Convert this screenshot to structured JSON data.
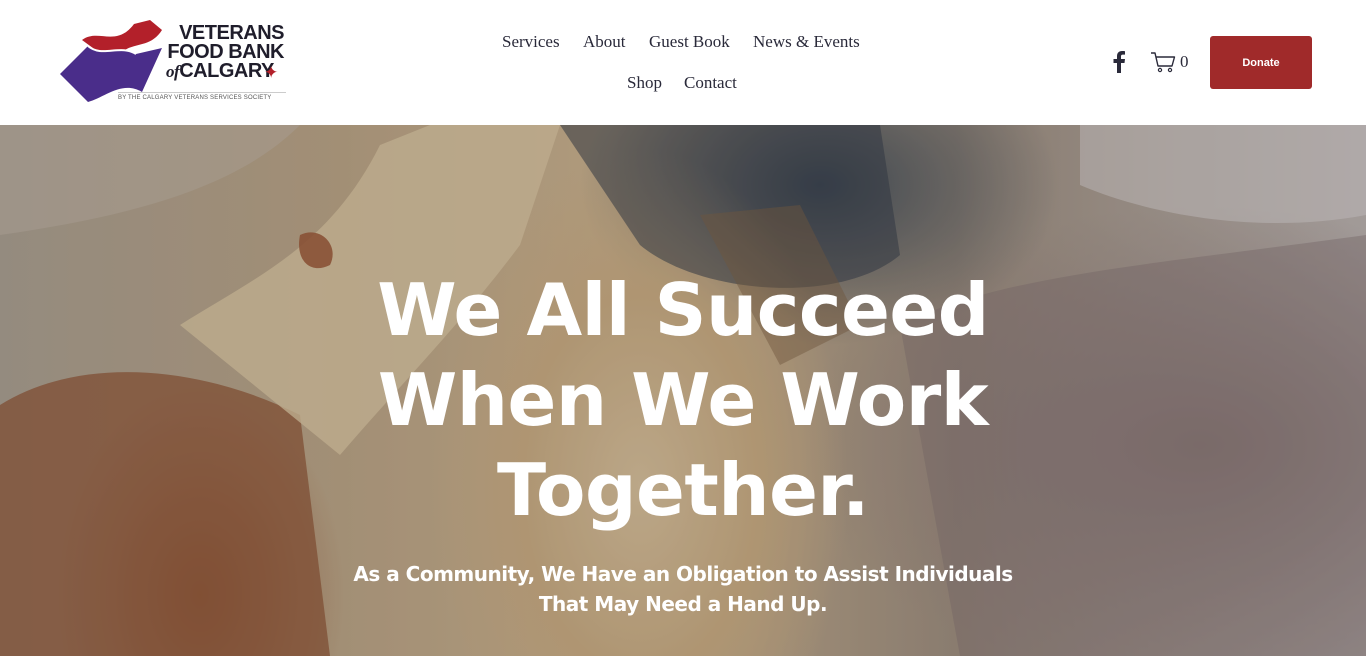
{
  "logo": {
    "line1": "VETERANS",
    "line2": "FOOD BANK",
    "line3_of": "of",
    "line3": "CALGARY",
    "tagline": "BY THE CALGARY VETERANS SERVICES SOCIETY",
    "maple_icon": "maple-leaf",
    "colors": {
      "red": "#b3202a",
      "purple": "#4a2d8a"
    }
  },
  "nav": {
    "items": [
      {
        "label": "Services"
      },
      {
        "label": "About"
      },
      {
        "label": "Guest Book"
      },
      {
        "label": "News & Events"
      },
      {
        "label": "Shop"
      },
      {
        "label": "Contact"
      }
    ]
  },
  "header_actions": {
    "social_icon": "facebook-icon",
    "cart_icon": "cart-icon",
    "cart_count": "0",
    "donate_label": "Donate",
    "donate_color": "#a02a2a"
  },
  "hero": {
    "heading": "We All Succeed When We Work Together.",
    "subheading": "As a Community, We Have an Obligation to Assist Individuals That May Need a Hand Up."
  }
}
